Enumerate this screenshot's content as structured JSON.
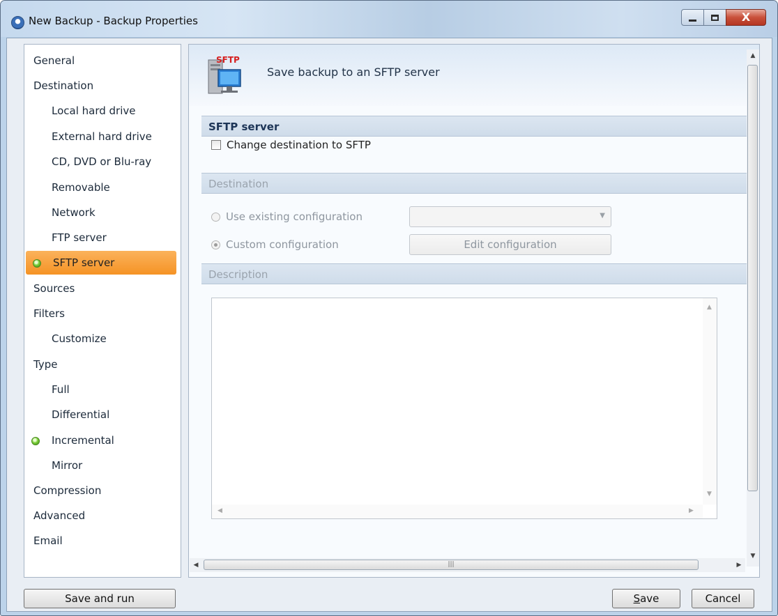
{
  "window": {
    "title": "New Backup - Backup Properties",
    "close_glyph": "X"
  },
  "nav": {
    "items": [
      {
        "label": "General",
        "level": 1
      },
      {
        "label": "Destination",
        "level": 1
      },
      {
        "label": "Local hard drive",
        "level": 2
      },
      {
        "label": "External hard drive",
        "level": 2
      },
      {
        "label": "CD, DVD or Blu-ray",
        "level": 2
      },
      {
        "label": "Removable",
        "level": 2
      },
      {
        "label": "Network",
        "level": 2
      },
      {
        "label": "FTP server",
        "level": 2
      },
      {
        "label": "SFTP server",
        "level": 2,
        "selected": true,
        "indicator": "green"
      },
      {
        "label": "Sources",
        "level": 1
      },
      {
        "label": "Filters",
        "level": 1
      },
      {
        "label": "Customize",
        "level": 2
      },
      {
        "label": "Type",
        "level": 1
      },
      {
        "label": "Full",
        "level": 2
      },
      {
        "label": "Differential",
        "level": 2
      },
      {
        "label": "Incremental",
        "level": 2,
        "indicator": "green"
      },
      {
        "label": "Mirror",
        "level": 2
      },
      {
        "label": "Compression",
        "level": 1
      },
      {
        "label": "Advanced",
        "level": 1
      },
      {
        "label": "Email",
        "level": 1
      }
    ]
  },
  "header": {
    "icon_text": "SFTP",
    "text": "Save backup to an SFTP server"
  },
  "sftp_section": {
    "title": "SFTP server",
    "change_destination_label": "Change destination to SFTP",
    "change_destination_checked": false
  },
  "destination_section": {
    "title": "Destination",
    "use_existing_label": "Use existing configuration",
    "custom_label": "Custom configuration",
    "selected": "custom",
    "existing_combo_value": "",
    "edit_button_label": "Edit configuration"
  },
  "description_section": {
    "title": "Description",
    "text": ""
  },
  "buttons": {
    "save_and_run": "Save and run",
    "save": "Save",
    "save_mnemonic": "S",
    "cancel": "Cancel"
  },
  "colors": {
    "selected_nav_bg": "#f7a33f",
    "indicator_green": "#5cb82a",
    "section_bg": "#d6e1ed"
  }
}
